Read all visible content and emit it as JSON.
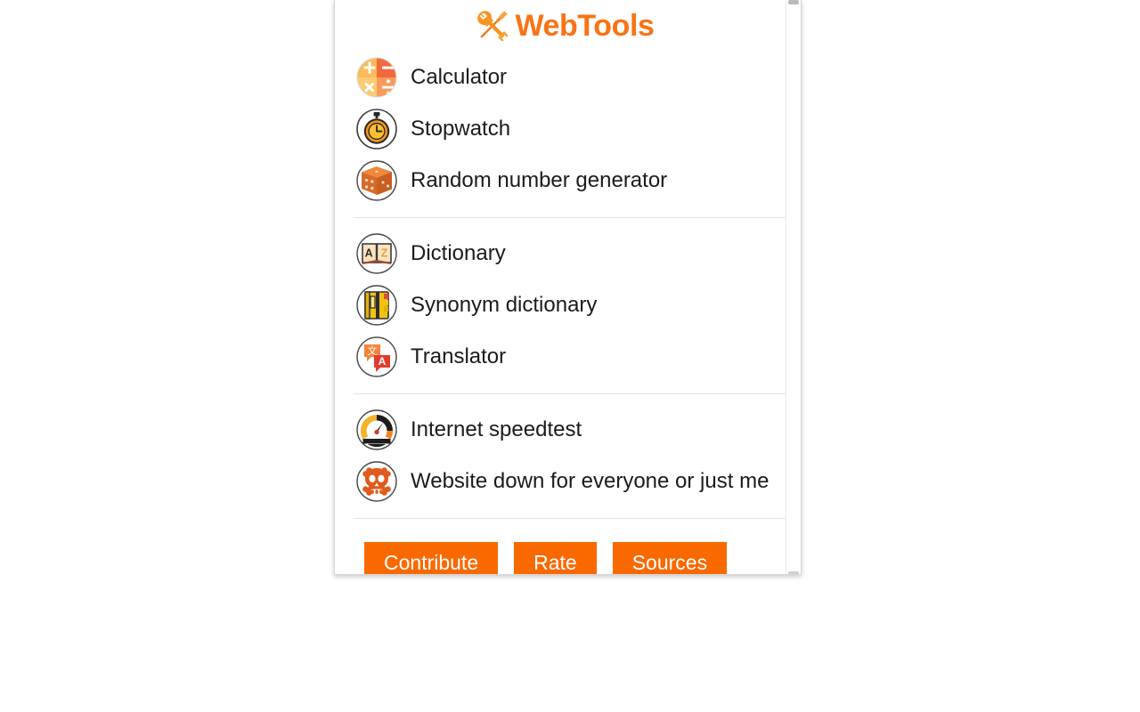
{
  "app": {
    "title": "WebTools",
    "logo_icon": "wrench-screwdriver-icon",
    "accent_color": "#F97316",
    "button_color": "#F96900"
  },
  "groups": [
    {
      "id": "utilities",
      "items": [
        {
          "id": "calculator",
          "label": "Calculator",
          "icon": "calculator-icon"
        },
        {
          "id": "stopwatch",
          "label": "Stopwatch",
          "icon": "stopwatch-icon"
        },
        {
          "id": "random-number-generator",
          "label": "Random number generator",
          "icon": "dice-icon"
        }
      ]
    },
    {
      "id": "language",
      "items": [
        {
          "id": "dictionary",
          "label": "Dictionary",
          "icon": "open-book-az-icon"
        },
        {
          "id": "synonym-dictionary",
          "label": "Synonym dictionary",
          "icon": "notebook-icon"
        },
        {
          "id": "translator",
          "label": "Translator",
          "icon": "translate-bubbles-icon"
        }
      ]
    },
    {
      "id": "network",
      "items": [
        {
          "id": "internet-speedtest",
          "label": "Internet speedtest",
          "icon": "speedometer-icon"
        },
        {
          "id": "website-down",
          "label": "Website down for everyone or just me",
          "icon": "skull-crossbones-icon"
        }
      ]
    }
  ],
  "footer": {
    "buttons": [
      {
        "id": "contribute",
        "label": "Contribute"
      },
      {
        "id": "rate",
        "label": "Rate"
      },
      {
        "id": "sources",
        "label": "Sources"
      }
    ]
  }
}
